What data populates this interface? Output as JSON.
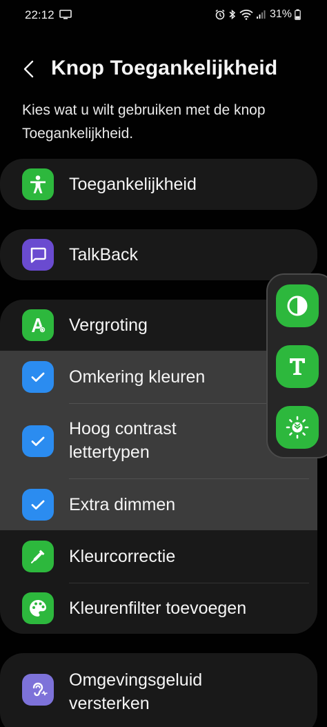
{
  "status_bar": {
    "time": "22:12",
    "battery": "31%",
    "icons": [
      "cast-icon",
      "alarm-icon",
      "bluetooth-icon",
      "wifi-icon",
      "signal-icon",
      "battery-icon"
    ]
  },
  "header": {
    "title": "Knop Toegankelijkheid",
    "back_icon": "back-arrow-icon"
  },
  "description": "Kies wat u wilt gebruiken met de knop Toegankelijkheid.",
  "colors": {
    "background": "#010101",
    "card": "#191919",
    "highlight": "#3c3c3c",
    "green": "#2db83d",
    "purple": "#6a4bd0",
    "blue": "#2b8cf0",
    "lavender": "#7d72d9"
  },
  "items": {
    "toegankelijkheid": {
      "label": "Toegankelijkheid",
      "icon": "accessibility-person-icon"
    },
    "talkback": {
      "label": "TalkBack",
      "icon": "talkback-chat-icon"
    },
    "vergroting": {
      "label": "Vergroting",
      "icon": "magnify-letter-icon"
    },
    "omkering": {
      "label": "Omkering kleuren",
      "icon": "check-icon",
      "checked": true
    },
    "hoog_contrast_line1": {
      "label": "Hoog contrast"
    },
    "hoog_contrast_line2": {
      "label": "lettertypen",
      "icon": "check-icon",
      "checked": true
    },
    "extra_dimmen": {
      "label": "Extra dimmen",
      "icon": "check-icon",
      "checked": true
    },
    "kleurcorrectie": {
      "label": "Kleurcorrectie",
      "icon": "color-dropper-icon"
    },
    "kleurenfilter": {
      "label": "Kleurenfilter toevoegen",
      "icon": "palette-icon"
    },
    "omgevingsgeluid_line1": {
      "label": "Omgevingsgeluid"
    },
    "omgevingsgeluid_line2": {
      "label": "versterken",
      "icon": "ear-icon"
    }
  },
  "floating_panel": {
    "buttons": [
      "invert-colors-icon",
      "high-contrast-text-icon",
      "extra-dim-icon"
    ]
  }
}
